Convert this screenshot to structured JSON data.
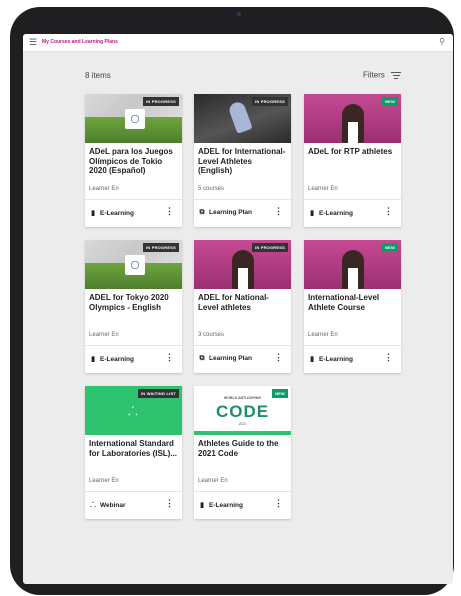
{
  "header": {
    "title": "My Courses and Learning Plans"
  },
  "list": {
    "count_label": "8 items",
    "filters_label": "Filters"
  },
  "cards": [
    {
      "title": "ADeL para los Juegos Olímpicos de Tokio 2020 (Español)",
      "subtitle": "Learner En",
      "badge": "IN PROGRESS",
      "type": "E-Learning",
      "type_icon": "document-icon",
      "thumb": "olympic"
    },
    {
      "title": "ADEL for International-Level Athletes (English)",
      "subtitle": "5 courses",
      "badge": "IN PROGRESS",
      "type": "Learning Plan",
      "type_icon": "learning-plan-icon",
      "thumb": "ski"
    },
    {
      "title": "ADeL for RTP athletes",
      "subtitle": "Learner En",
      "badge": "NEW",
      "type": "E-Learning",
      "type_icon": "document-icon",
      "thumb": "pink"
    },
    {
      "title": "ADEL for Tokyo 2020 Olympics - English",
      "subtitle": "Learner En",
      "badge": "IN PROGRESS",
      "type": "E-Learning",
      "type_icon": "document-icon",
      "thumb": "olympic"
    },
    {
      "title": "ADEL for National-Level athletes",
      "subtitle": "3 courses",
      "badge": "IN PROGRESS",
      "type": "Learning Plan",
      "type_icon": "learning-plan-icon",
      "thumb": "pink"
    },
    {
      "title": "International-Level Athlete Course",
      "subtitle": "Learner En",
      "badge": "NEW",
      "type": "E-Learning",
      "type_icon": "document-icon",
      "thumb": "pink"
    },
    {
      "title": "International Standard for Laboratories (ISL)...",
      "subtitle": "Learner En",
      "badge": "IN WAITING LIST",
      "type": "Webinar",
      "type_icon": "webinar-icon",
      "thumb": "webinar"
    },
    {
      "title": "Athletes Guide to the 2021 Code",
      "subtitle": "Learner En",
      "badge": "NEW",
      "type": "E-Learning",
      "type_icon": "document-icon",
      "thumb": "code"
    }
  ],
  "code_thumb": {
    "top": "WORLD ANTI-DOPING",
    "main": "CODE",
    "year": "2021"
  },
  "colors": {
    "accent": "#c01b7f",
    "new_badge": "#0f9a6a",
    "progress_badge": "#333333",
    "webinar_green": "#2ec46f"
  }
}
